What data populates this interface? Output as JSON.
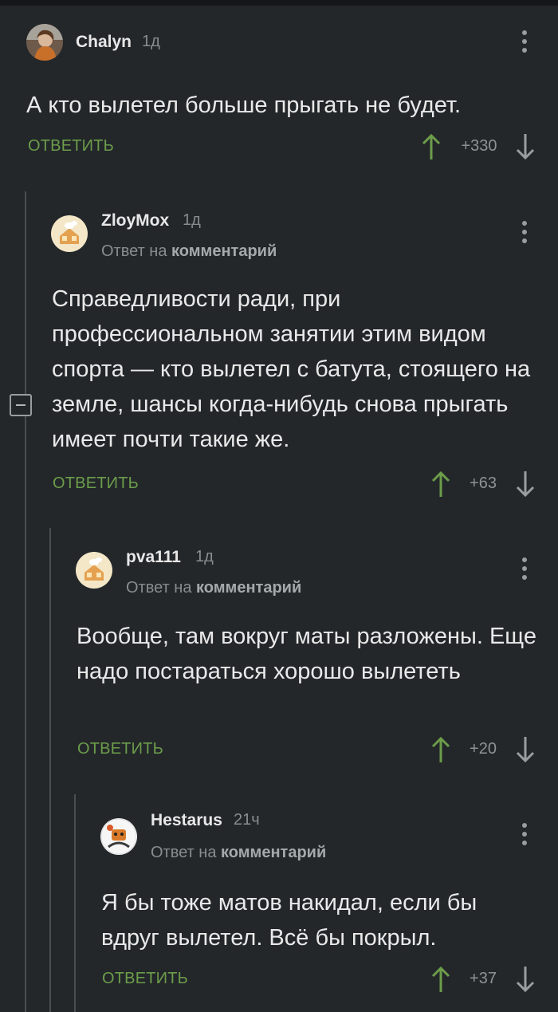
{
  "comments": [
    {
      "username": "Chalyn",
      "time": "1д",
      "avatar": "user-avatar-photo",
      "reply_to_prefix": "",
      "reply_to_link": "",
      "text": "А кто вылетел больше прыгать не будет.",
      "reply_label": "ОТВЕТИТЬ",
      "score": "+330"
    },
    {
      "username": "ZloyMox",
      "time": "1д",
      "avatar": "default-avatar-house",
      "reply_to_prefix": "Ответ на",
      "reply_to_link": "комментарий",
      "text": "Справедливости ради, при профессиональном занятии этим видом спорта — кто вылетел с батута, стоящего на земле, шансы когда-нибудь снова прыгать имеет почти такие же.",
      "reply_label": "ОТВЕТИТЬ",
      "score": "+63"
    },
    {
      "username": "pva111",
      "time": "1д",
      "avatar": "default-avatar-house",
      "reply_to_prefix": "Ответ на",
      "reply_to_link": "комментарий",
      "text": "Вообще, там вокруг маты разложены. Еще надо постараться хорошо вылететь",
      "reply_label": "ОТВЕТИТЬ",
      "score": "+20"
    },
    {
      "username": "Hestarus",
      "time": "21ч",
      "avatar": "user-avatar-cartoon",
      "reply_to_prefix": "Ответ на",
      "reply_to_link": "комментарий",
      "text": "Я бы тоже матов накидал, если бы вдруг вылетел. Всё бы покрыл.",
      "reply_label": "ОТВЕТИТЬ",
      "score": "+37"
    }
  ],
  "colors": {
    "background": "#23272a",
    "reply_green": "#6c9d4a",
    "upvote_green": "#6c9d4a",
    "muted": "#8a8d90"
  },
  "icons": {
    "upvote": "arrow-up-icon",
    "downvote": "arrow-down-icon",
    "menu": "more-vertical-icon",
    "collapse": "minus-square-icon"
  }
}
